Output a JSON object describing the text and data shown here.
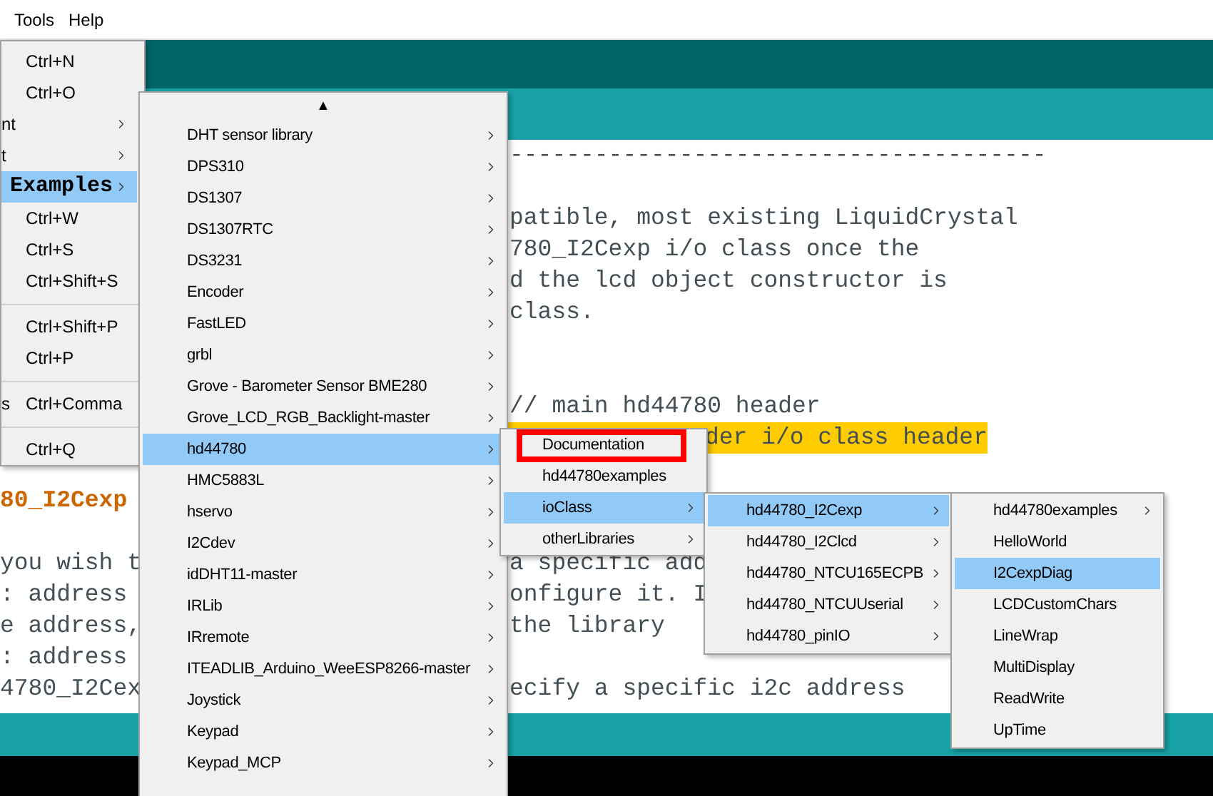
{
  "menu_bar": [
    {
      "label": "Tools"
    },
    {
      "label": "Help"
    }
  ],
  "editor": {
    "lines": [
      {
        "kind": "code",
        "right": "--------------------------------------"
      },
      {
        "kind": "blank"
      },
      {
        "kind": "code",
        "right": "patible, most existing LiquidCrystal"
      },
      {
        "kind": "code",
        "right": "780_I2Cexp i/o class once the"
      },
      {
        "kind": "code",
        "right": "d the lcd object constructor is"
      },
      {
        "kind": "code",
        "right": "class."
      },
      {
        "kind": "blank"
      },
      {
        "kind": "blank"
      },
      {
        "kind": "code",
        "right": "// main hd44780 header"
      },
      {
        "kind": "highlight",
        "right": "der i/o class header"
      },
      {
        "kind": "blank"
      },
      {
        "kind": "heading",
        "left": "80_I2Cexp"
      },
      {
        "kind": "blank"
      },
      {
        "kind": "code",
        "left": "you wish t",
        "right": "a specific add"
      },
      {
        "kind": "code",
        "left": ": address",
        "right": "onfigure it. I"
      },
      {
        "kind": "code",
        "left": "e address,",
        "right": "the library"
      },
      {
        "kind": "code",
        "left": ": address"
      },
      {
        "kind": "code",
        "left": "4780_I2Cex",
        "right": "ecify a specific i2c address"
      }
    ]
  },
  "menus": [
    {
      "kind": "file",
      "items": [
        {
          "kind": "item",
          "shortcut": "Ctrl+N",
          "submenu": false,
          "selected": false
        },
        {
          "kind": "item",
          "shortcut": "Ctrl+O",
          "submenu": false,
          "selected": false
        },
        {
          "kind": "item",
          "label": "nt",
          "submenu": true,
          "selected": false
        },
        {
          "kind": "item",
          "label": "t",
          "submenu": true,
          "selected": false
        },
        {
          "kind": "item",
          "label": "Examples",
          "submenu": true,
          "selected": true
        },
        {
          "kind": "item",
          "shortcut": "Ctrl+W",
          "submenu": false,
          "selected": false
        },
        {
          "kind": "item",
          "shortcut": "Ctrl+S",
          "submenu": false,
          "selected": false
        },
        {
          "kind": "item",
          "shortcut": "Ctrl+Shift+S",
          "submenu": false,
          "selected": false
        },
        {
          "kind": "separator"
        },
        {
          "kind": "item",
          "shortcut": "Ctrl+Shift+P",
          "submenu": false,
          "selected": false
        },
        {
          "kind": "item",
          "shortcut": "Ctrl+P",
          "submenu": false,
          "selected": false
        },
        {
          "kind": "separator"
        },
        {
          "kind": "item",
          "label": "s",
          "shortcut": "Ctrl+Comma",
          "submenu": false,
          "selected": false
        },
        {
          "kind": "separator"
        },
        {
          "kind": "item",
          "shortcut": "Ctrl+Q",
          "submenu": false,
          "selected": false
        }
      ]
    },
    {
      "kind": "examples",
      "scroll_up": "▲",
      "items": [
        {
          "kind": "item",
          "label": "DHT sensor library",
          "submenu": true,
          "selected": false
        },
        {
          "kind": "item",
          "label": "DPS310",
          "submenu": true,
          "selected": false
        },
        {
          "kind": "item",
          "label": "DS1307",
          "submenu": true,
          "selected": false
        },
        {
          "kind": "item",
          "label": "DS1307RTC",
          "submenu": true,
          "selected": false
        },
        {
          "kind": "item",
          "label": "DS3231",
          "submenu": true,
          "selected": false
        },
        {
          "kind": "item",
          "label": "Encoder",
          "submenu": true,
          "selected": false
        },
        {
          "kind": "item",
          "label": "FastLED",
          "submenu": true,
          "selected": false
        },
        {
          "kind": "item",
          "label": "grbl",
          "submenu": true,
          "selected": false
        },
        {
          "kind": "item",
          "label": "Grove - Barometer Sensor BME280",
          "submenu": true,
          "selected": false
        },
        {
          "kind": "item",
          "label": "Grove_LCD_RGB_Backlight-master",
          "submenu": true,
          "selected": false
        },
        {
          "kind": "item",
          "label": "hd44780",
          "submenu": true,
          "selected": true
        },
        {
          "kind": "item",
          "label": "HMC5883L",
          "submenu": true,
          "selected": false
        },
        {
          "kind": "item",
          "label": "hservo",
          "submenu": true,
          "selected": false
        },
        {
          "kind": "item",
          "label": "I2Cdev",
          "submenu": true,
          "selected": false
        },
        {
          "kind": "item",
          "label": "idDHT11-master",
          "submenu": true,
          "selected": false
        },
        {
          "kind": "item",
          "label": "IRLib",
          "submenu": true,
          "selected": false
        },
        {
          "kind": "item",
          "label": "IRremote",
          "submenu": true,
          "selected": false
        },
        {
          "kind": "item",
          "label": "ITEADLIB_Arduino_WeeESP8266-master",
          "submenu": true,
          "selected": false
        },
        {
          "kind": "item",
          "label": "Joystick",
          "submenu": true,
          "selected": false
        },
        {
          "kind": "item",
          "label": "Keypad",
          "submenu": true,
          "selected": false
        },
        {
          "kind": "item",
          "label": "Keypad_MCP",
          "submenu": true,
          "selected": false
        }
      ]
    },
    {
      "kind": "sub",
      "items": [
        {
          "kind": "item",
          "label": "Documentation",
          "submenu": false,
          "selected": false,
          "annotated": true
        },
        {
          "kind": "item",
          "label": "hd44780examples",
          "submenu": false,
          "selected": false,
          "annotated": false
        },
        {
          "kind": "item",
          "label": "ioClass",
          "submenu": true,
          "selected": true,
          "annotated": false
        },
        {
          "kind": "item",
          "label": "otherLibraries",
          "submenu": true,
          "selected": false,
          "annotated": false
        }
      ]
    },
    {
      "kind": "sub",
      "items": [
        {
          "kind": "item",
          "label": "hd44780_I2Cexp",
          "submenu": true,
          "selected": true
        },
        {
          "kind": "item",
          "label": "hd44780_I2Clcd",
          "submenu": true,
          "selected": false
        },
        {
          "kind": "item",
          "label": "hd44780_NTCU165ECPB",
          "submenu": true,
          "selected": false
        },
        {
          "kind": "item",
          "label": "hd44780_NTCUUserial",
          "submenu": true,
          "selected": false
        },
        {
          "kind": "item",
          "label": "hd44780_pinIO",
          "submenu": true,
          "selected": false
        }
      ]
    },
    {
      "kind": "sub",
      "items": [
        {
          "kind": "item",
          "label": "hd44780examples",
          "submenu": true,
          "selected": false
        },
        {
          "kind": "item",
          "label": "HelloWorld",
          "submenu": false,
          "selected": false
        },
        {
          "kind": "item",
          "label": "I2CexpDiag",
          "submenu": false,
          "selected": true
        },
        {
          "kind": "item",
          "label": "LCDCustomChars",
          "submenu": false,
          "selected": false
        },
        {
          "kind": "item",
          "label": "LineWrap",
          "submenu": false,
          "selected": false
        },
        {
          "kind": "item",
          "label": "MultiDisplay",
          "submenu": false,
          "selected": false
        },
        {
          "kind": "item",
          "label": "ReadWrite",
          "submenu": false,
          "selected": false
        },
        {
          "kind": "item",
          "label": "UpTime",
          "submenu": false,
          "selected": false
        }
      ]
    }
  ]
}
